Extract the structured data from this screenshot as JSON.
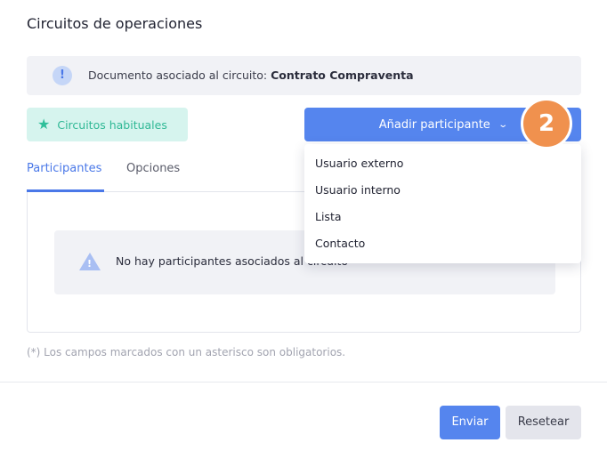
{
  "page": {
    "title": "Circuitos de operaciones"
  },
  "info": {
    "text": "Documento asociado al circuito:",
    "document": "Contrato Compraventa",
    "icon": "info-icon"
  },
  "actions": {
    "habitual_label": "Circuitos habituales",
    "add_participant_label": "Añadir participante",
    "step_badge": "2"
  },
  "dropdown": {
    "items": [
      "Usuario externo",
      "Usuario interno",
      "Lista",
      "Contacto"
    ]
  },
  "tabs": [
    {
      "label": "Participantes",
      "active": true
    },
    {
      "label": "Opciones",
      "active": false
    }
  ],
  "empty_state": {
    "message": "No hay participantes asociados al circuito"
  },
  "footer": {
    "required_note": "(*) Los campos marcados con un asterisco son obligatorios.",
    "send_label": "Enviar",
    "reset_label": "Resetear"
  },
  "colors": {
    "primary": "#5585ee",
    "teal_bg": "#d6f4ee",
    "teal_text": "#2fb895",
    "badge": "#f0914e"
  }
}
